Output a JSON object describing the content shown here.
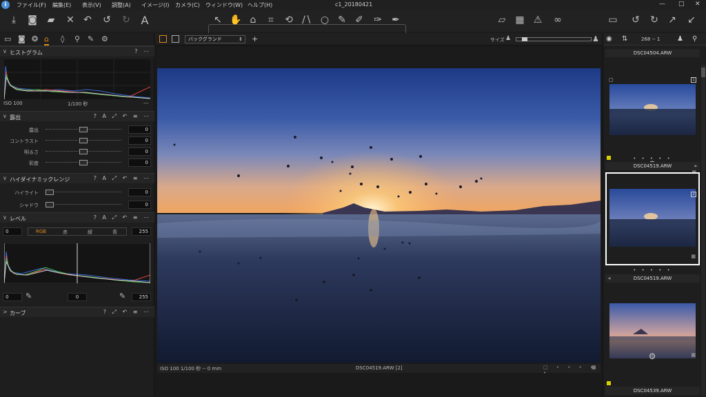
{
  "window": {
    "title": "c1_20180421"
  },
  "menu": [
    "ファイル(F)",
    "編集(E)",
    "表示(V)",
    "調整(A)",
    "イメージ(I)",
    "カメラ(C)",
    "ウィンドウ(W)",
    "ヘルプ(H)"
  ],
  "histogram": {
    "title": "ヒストグラム",
    "iso": "ISO 100",
    "shutter": "1/100 秒",
    "extra": "---"
  },
  "exposure": {
    "title": "露出",
    "sliders": [
      {
        "label": "露出",
        "value": "0",
        "pos": 0.5
      },
      {
        "label": "コントラスト",
        "value": "0",
        "pos": 0.5
      },
      {
        "label": "明るさ",
        "value": "0",
        "pos": 0.5
      },
      {
        "label": "彩度",
        "value": "0",
        "pos": 0.5
      }
    ]
  },
  "hdr": {
    "title": "ハイダイナミックレンジ",
    "sliders": [
      {
        "label": "ハイライト",
        "value": "0",
        "pos": 0.0
      },
      {
        "label": "シャドウ",
        "value": "0",
        "pos": 0.0
      }
    ]
  },
  "levels": {
    "title": "レベル",
    "input_low": "0",
    "input_high": "255",
    "channels": [
      "RGB",
      "赤",
      "緑",
      "青"
    ],
    "out_low": "0",
    "mid": "0",
    "out_high": "255"
  },
  "curve": {
    "title": "カーブ"
  },
  "viewer": {
    "preset": "バックグランド",
    "size_label": "サイズ",
    "status_left": "ISO 100  1/100 秒 -- 0 mm",
    "status_center": "DSC04519.ARW [2]"
  },
  "browser": {
    "count": "268 -- 1",
    "items": [
      {
        "name": "DSC04504.ARW"
      },
      {
        "name": "DSC04519.ARW",
        "badge": "1"
      },
      {
        "name": "DSC04519.ARW",
        "badge": "2",
        "selected": true
      },
      {
        "name": "DSC04539.ARW"
      }
    ]
  },
  "colors": {
    "accent": "#e08a1e",
    "selected_border": "#ffffff",
    "color_tag": "#d8d000"
  }
}
